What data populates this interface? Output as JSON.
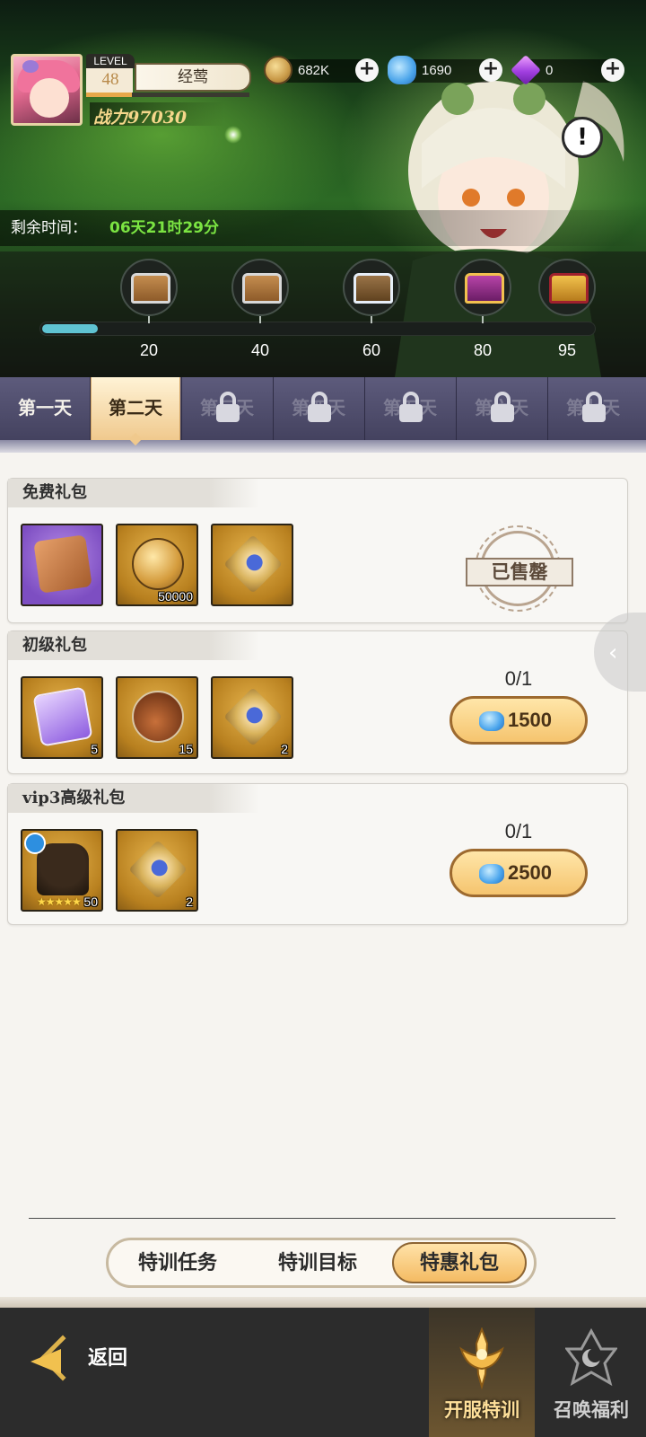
{
  "header": {
    "level_label": "LEVEL",
    "level": "48",
    "player_name": "经莺",
    "exp_fraction": 0.28,
    "power_label": "战力97030",
    "currencies": [
      {
        "icon": "gold-coin-icon",
        "value": "682K"
      },
      {
        "icon": "diamond-icon",
        "value": "1690"
      },
      {
        "icon": "purple-gem-icon",
        "value": "0"
      }
    ],
    "info_symbol": "!"
  },
  "timer": {
    "label": "剩余时间：",
    "value": "06天21时29分"
  },
  "chest_progress": {
    "fraction": 0.1,
    "milestones": [
      "20",
      "40",
      "60",
      "80",
      "95"
    ]
  },
  "day_tabs": [
    {
      "label": "第一天",
      "state": "normal"
    },
    {
      "label": "第二天",
      "state": "active"
    },
    {
      "label": "第三天",
      "state": "locked"
    },
    {
      "label": "第四天",
      "state": "locked"
    },
    {
      "label": "第五天",
      "state": "locked"
    },
    {
      "label": "第六天",
      "state": "locked"
    },
    {
      "label": "第七天",
      "state": "locked"
    }
  ],
  "packs": [
    {
      "title": "免费礼包",
      "items": [
        {
          "icon": "scroll-icon",
          "count": ""
        },
        {
          "icon": "gold-coin-icon",
          "count": "50000"
        },
        {
          "icon": "star-medal-icon",
          "count": ""
        }
      ],
      "status": "已售罄"
    },
    {
      "title": "初级礼包",
      "items": [
        {
          "icon": "winged-card-icon",
          "count": "5"
        },
        {
          "icon": "potion-bottle-icon",
          "count": "15"
        },
        {
          "icon": "star-medal-icon",
          "count": "2"
        }
      ],
      "limit": "0/1",
      "price": "1500"
    },
    {
      "title": "vip3高级礼包",
      "items": [
        {
          "icon": "hero-shard-icon",
          "count": "50"
        },
        {
          "icon": "star-medal-icon",
          "count": "2"
        }
      ],
      "limit": "0/1",
      "price": "2500"
    }
  ],
  "sub_tabs": [
    "特训任务",
    "特训目标",
    "特惠礼包"
  ],
  "sub_tab_active": "特惠礼包",
  "nav": {
    "back_label": "返回",
    "items": [
      {
        "label": "开服特训",
        "active": true
      },
      {
        "label": "召唤福利",
        "active": false
      }
    ]
  }
}
